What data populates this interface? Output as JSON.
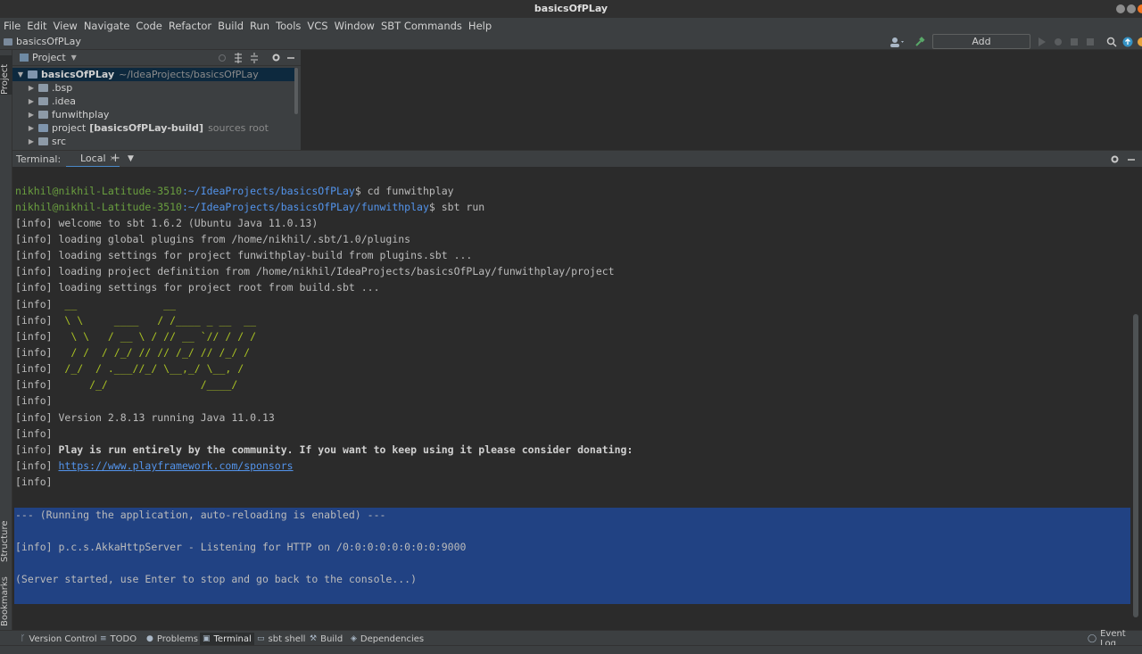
{
  "window": {
    "title": "basicsOfPLay"
  },
  "menu": [
    "File",
    "Edit",
    "View",
    "Navigate",
    "Code",
    "Refactor",
    "Build",
    "Run",
    "Tools",
    "VCS",
    "Window",
    "SBT Commands",
    "Help"
  ],
  "nav": {
    "breadcrumb": "basicsOfPLay",
    "add_configuration": "Add Configuration..."
  },
  "left_strip": {
    "project": "Project",
    "structure": "Structure",
    "bookmarks": "Bookmarks"
  },
  "project_panel": {
    "title": "Project",
    "tree": [
      {
        "name": "basicsOfPLay",
        "hint": "~/IdeaProjects/basicsOfPLay"
      },
      {
        "name": ".bsp"
      },
      {
        "name": ".idea"
      },
      {
        "name": "funwithplay"
      },
      {
        "name": "project",
        "bold": "[basicsOfPLay-build]",
        "hint": "sources root"
      },
      {
        "name": "src"
      }
    ]
  },
  "terminal": {
    "label": "Terminal:",
    "tab": "Local",
    "prompt_user": "nikhil@nikhil-Latitude-3510",
    "path1": ":~/IdeaProjects/basicsOfPLay",
    "cmd1": "$ cd funwithplay",
    "path2": ":~/IdeaProjects/basicsOfPLay/funwithplay",
    "cmd2": "$ sbt run",
    "lines": [
      "[info] welcome to sbt 1.6.2 (Ubuntu Java 11.0.13)",
      "[info] loading global plugins from /home/nikhil/.sbt/1.0/plugins",
      "[info] loading settings for project funwithplay-build from plugins.sbt ...",
      "[info] loading project definition from /home/nikhil/IdeaProjects/basicsOfPLay/funwithplay/project",
      "[info] loading settings for project root from build.sbt ..."
    ],
    "info_prefix": "[info]",
    "ascii": [
      "  __              __",
      "  \\ \\     ____   / /____ _ __  __",
      "   \\ \\   / __ \\ / // __ `// / / /",
      "   / /  / /_/ // // /_/ // /_/ /",
      "  /_/  / .___//_/ \\__,_/ \\__, /",
      "      /_/               /____/"
    ],
    "version_line": "[info] Version 2.8.13 running Java 11.0.13",
    "community_text": "Play is run entirely by the community. If you want to keep using it please consider donating:",
    "sponsor_link": "https://www.playframework.com/sponsors",
    "running_line": "--- (Running the application, auto-reloading is enabled) ---",
    "listening_line": "[info] p.c.s.AkkaHttpServer - Listening for HTTP on /0:0:0:0:0:0:0:0:9000",
    "server_line": "(Server started, use Enter to stop and go back to the console...)"
  },
  "bottom_tools": [
    "Version Control",
    "TODO",
    "Problems",
    "Terminal",
    "sbt shell",
    "Build",
    "Dependencies"
  ],
  "event_log": "Event Log"
}
